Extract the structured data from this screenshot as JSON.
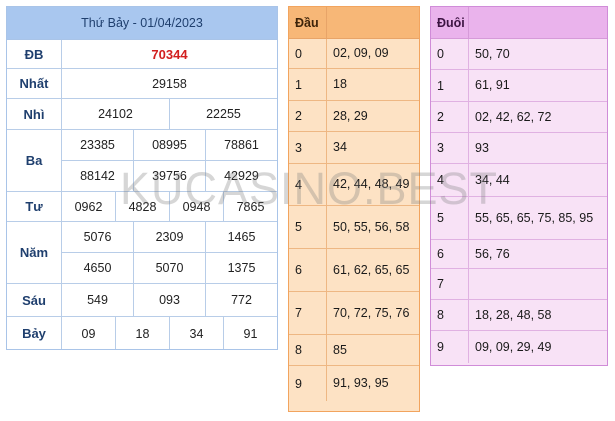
{
  "results": {
    "header": "Thứ Bảy - 01/04/2023",
    "prizes": [
      {
        "label": "ĐB",
        "rows": [
          [
            "70344"
          ]
        ],
        "special": true,
        "height": 29
      },
      {
        "label": "Nhất",
        "rows": [
          [
            "29158"
          ]
        ],
        "height": 30
      },
      {
        "label": "Nhì",
        "rows": [
          [
            "24102",
            "22255"
          ]
        ],
        "height": 31
      },
      {
        "label": "Ba",
        "rows": [
          [
            "23385",
            "08995",
            "78861"
          ],
          [
            "88142",
            "39756",
            "42929"
          ]
        ],
        "height": 62
      },
      {
        "label": "Tư",
        "rows": [
          [
            "0962",
            "4828",
            "0948",
            "7865"
          ]
        ],
        "height": 30
      },
      {
        "label": "Năm",
        "rows": [
          [
            "5076",
            "2309",
            "1465"
          ],
          [
            "4650",
            "5070",
            "1375"
          ]
        ],
        "height": 62
      },
      {
        "label": "Sáu",
        "rows": [
          [
            "549",
            "093",
            "772"
          ]
        ],
        "height": 33
      },
      {
        "label": "Bảy",
        "rows": [
          [
            "09",
            "18",
            "34",
            "91"
          ]
        ],
        "height": 33
      }
    ]
  },
  "dau": {
    "header": "Đầu",
    "rows": [
      {
        "k": "0",
        "v": "02, 09, 09",
        "h": 30
      },
      {
        "k": "1",
        "v": "18",
        "h": 32
      },
      {
        "k": "2",
        "v": "28, 29",
        "h": 31
      },
      {
        "k": "3",
        "v": "34",
        "h": 32
      },
      {
        "k": "4",
        "v": "42, 44, 48, 49",
        "h": 42
      },
      {
        "k": "5",
        "v": "50, 55, 56, 58",
        "h": 43
      },
      {
        "k": "6",
        "v": "61, 62, 65, 65",
        "h": 43
      },
      {
        "k": "7",
        "v": "70, 72, 75, 76",
        "h": 43
      },
      {
        "k": "8",
        "v": "85",
        "h": 31
      },
      {
        "k": "9",
        "v": "91, 93, 95",
        "h": 35
      }
    ]
  },
  "duoi": {
    "header": "Đuôi",
    "rows": [
      {
        "k": "0",
        "v": "50, 70",
        "h": 31
      },
      {
        "k": "1",
        "v": "61, 91",
        "h": 32
      },
      {
        "k": "2",
        "v": "02, 42, 62, 72",
        "h": 31
      },
      {
        "k": "3",
        "v": "93",
        "h": 31
      },
      {
        "k": "4",
        "v": "34, 44",
        "h": 33
      },
      {
        "k": "5",
        "v": "55, 65, 65, 75, 85, 95",
        "h": 43
      },
      {
        "k": "6",
        "v": "56, 76",
        "h": 29
      },
      {
        "k": "7",
        "v": "",
        "h": 31
      },
      {
        "k": "8",
        "v": "18, 28, 48, 58",
        "h": 31
      },
      {
        "k": "9",
        "v": "09, 09, 29, 49",
        "h": 32
      }
    ]
  },
  "watermark": "KUCASINO.BEST"
}
